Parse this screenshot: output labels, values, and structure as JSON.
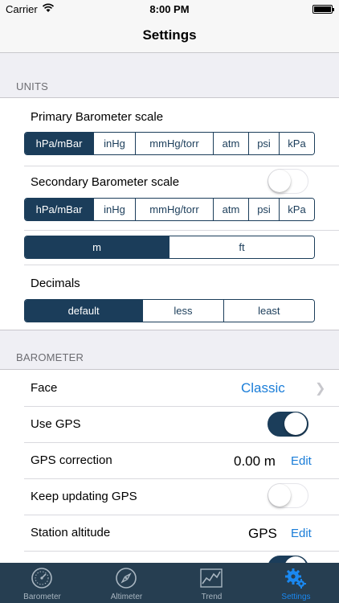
{
  "status": {
    "carrier": "Carrier",
    "time": "8:00 PM"
  },
  "nav": {
    "title": "Settings"
  },
  "units": {
    "header": "UNITS",
    "primary_label": "Primary Barometer scale",
    "primary_options": [
      "hPa/mBar",
      "inHg",
      "mmHg/torr",
      "atm",
      "psi",
      "kPa"
    ],
    "primary_selected": "hPa/mBar",
    "secondary_label": "Secondary Barometer scale",
    "secondary_enabled": false,
    "secondary_options": [
      "hPa/mBar",
      "inHg",
      "mmHg/torr",
      "atm",
      "psi",
      "kPa"
    ],
    "secondary_selected": "hPa/mBar",
    "altitude_options": [
      "m",
      "ft"
    ],
    "altitude_selected": "m",
    "decimals_label": "Decimals",
    "decimals_options": [
      "default",
      "less",
      "least"
    ],
    "decimals_selected": "default"
  },
  "barometer": {
    "header": "BAROMETER",
    "face_label": "Face",
    "face_value": "Classic",
    "use_gps_label": "Use GPS",
    "use_gps_enabled": true,
    "gps_correction_label": "GPS correction",
    "gps_correction_value": "0.00 m",
    "gps_correction_edit": "Edit",
    "keep_updating_label": "Keep updating GPS",
    "keep_updating_enabled": false,
    "station_altitude_label": "Station altitude",
    "station_altitude_value": "GPS",
    "station_altitude_edit": "Edit"
  },
  "tabs": [
    {
      "label": "Barometer",
      "icon": "gauge-icon",
      "active": false
    },
    {
      "label": "Altimeter",
      "icon": "compass-icon",
      "active": false
    },
    {
      "label": "Trend",
      "icon": "trend-chart-icon",
      "active": false
    },
    {
      "label": "Settings",
      "icon": "gear-icon",
      "active": true
    }
  ],
  "colors": {
    "accent": "#1b3d5a",
    "link": "#1a7dd8",
    "tabbar": "#263e51",
    "tab_active": "#1a88f0"
  }
}
